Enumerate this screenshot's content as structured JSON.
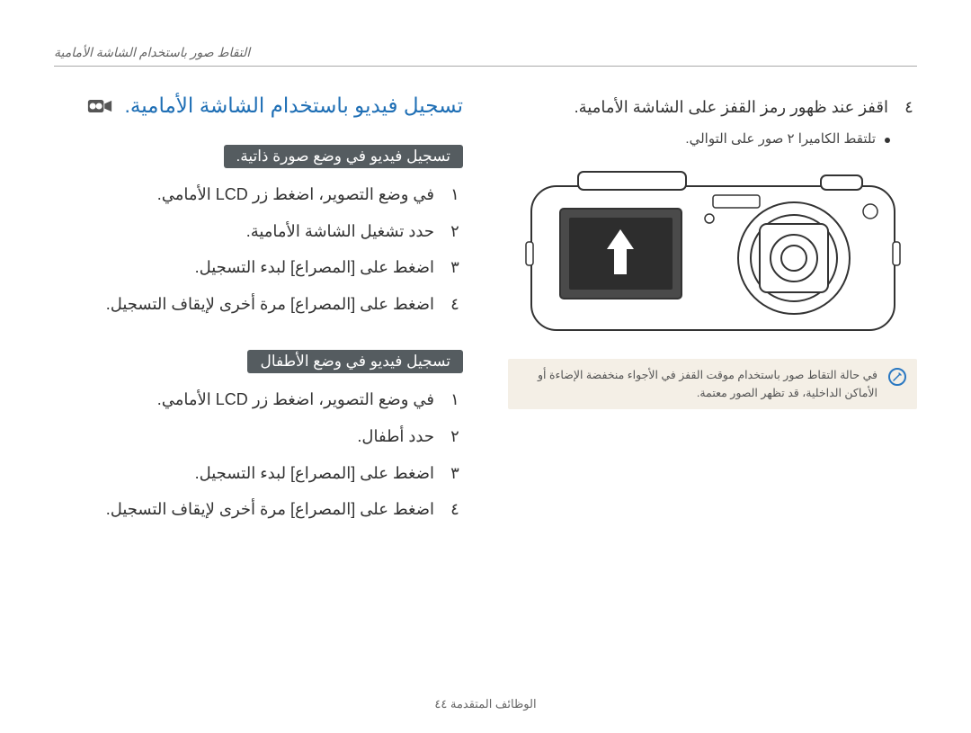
{
  "header": {
    "title": "التقاط صور باستخدام الشاشة الأمامية"
  },
  "right": {
    "step4": {
      "num": "٤",
      "text": "اقفز عند ظهور رمز القفز على الشاشة الأمامية."
    },
    "bullet": "تلتقط الكاميرا ٢ صور على التوالي.",
    "note": "في حالة التقاط صور باستخدام موقت القفز في الأجواء منخفضة الإضاءة أو الأماكن الداخلية، قد تظهر الصور معتمة."
  },
  "left": {
    "title": "تسجيل فيديو باستخدام الشاشة الأمامية.",
    "groupA": {
      "heading": "تسجيل فيديو في وضع صورة ذاتية.",
      "steps": [
        {
          "num": "١",
          "text": "في وضع التصوير، اضغط زر LCD الأمامي."
        },
        {
          "num": "٢",
          "text": "حدد تشغيل الشاشة الأمامية."
        },
        {
          "num": "٣",
          "text": "اضغط على [المصراع] لبدء التسجيل."
        },
        {
          "num": "٤",
          "text": "اضغط على [المصراع] مرة أخرى لإيقاف التسجيل."
        }
      ]
    },
    "groupB": {
      "heading": "تسجيل فيديو في وضع الأطفال",
      "steps": [
        {
          "num": "١",
          "text": "في وضع التصوير، اضغط زر LCD الأمامي."
        },
        {
          "num": "٢",
          "text": "حدد أطفال."
        },
        {
          "num": "٣",
          "text": "اضغط على [المصراع] لبدء التسجيل."
        },
        {
          "num": "٤",
          "text": "اضغط على [المصراع] مرة أخرى لإيقاف التسجيل."
        }
      ]
    }
  },
  "footer": {
    "text": "الوظائف المتقدمة  ٤٤"
  },
  "icons": {
    "note": "✎",
    "video": "video-camera"
  }
}
